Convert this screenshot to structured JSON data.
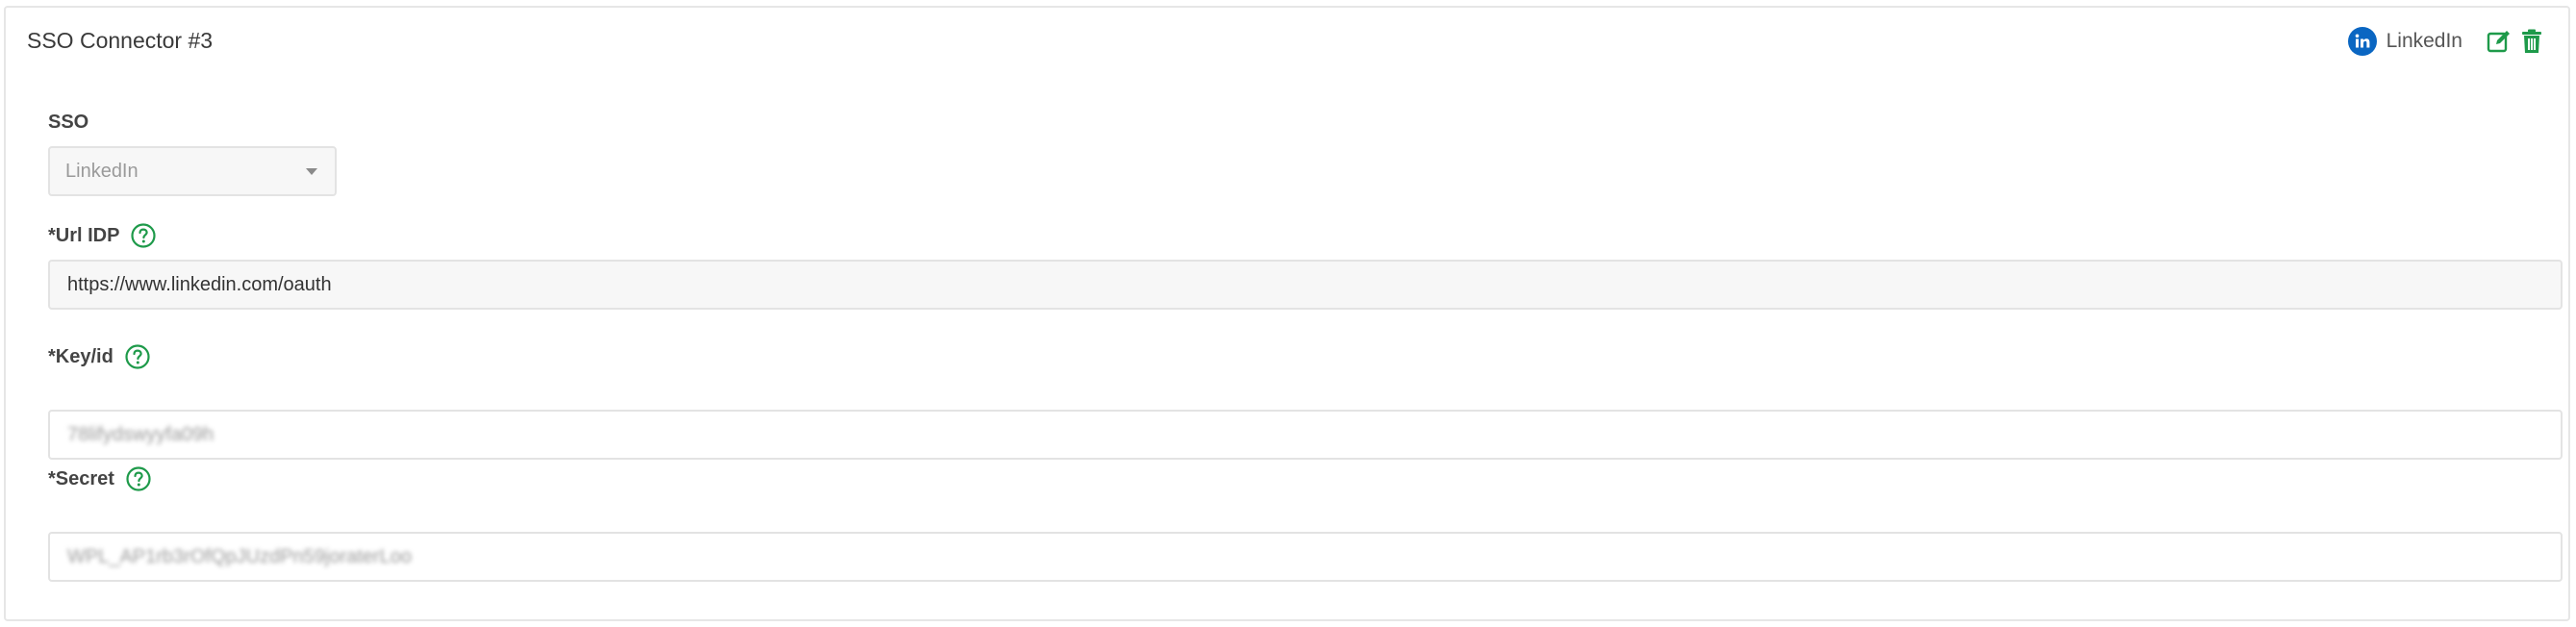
{
  "card": {
    "title": "SSO Connector #3",
    "provider_label": "LinkedIn"
  },
  "fields": {
    "sso": {
      "label": "SSO",
      "selected": "LinkedIn"
    },
    "url_idp": {
      "label": "*Url IDP",
      "value": "https://www.linkedin.com/oauth"
    },
    "key_id": {
      "label": "*Key/id",
      "value": "78lifydswyyfa09h"
    },
    "secret": {
      "label": "*Secret",
      "value": "WPL_AP1rb3rOfQpJUzdPn59joraterLoo"
    }
  },
  "colors": {
    "accent_green": "#1e9a4a",
    "linkedin_blue": "#0a66c2"
  },
  "icons": {
    "provider": "linkedin-icon",
    "edit": "edit-icon",
    "delete": "trash-icon",
    "help": "question-circle-icon",
    "select": "caret-down-icon"
  }
}
